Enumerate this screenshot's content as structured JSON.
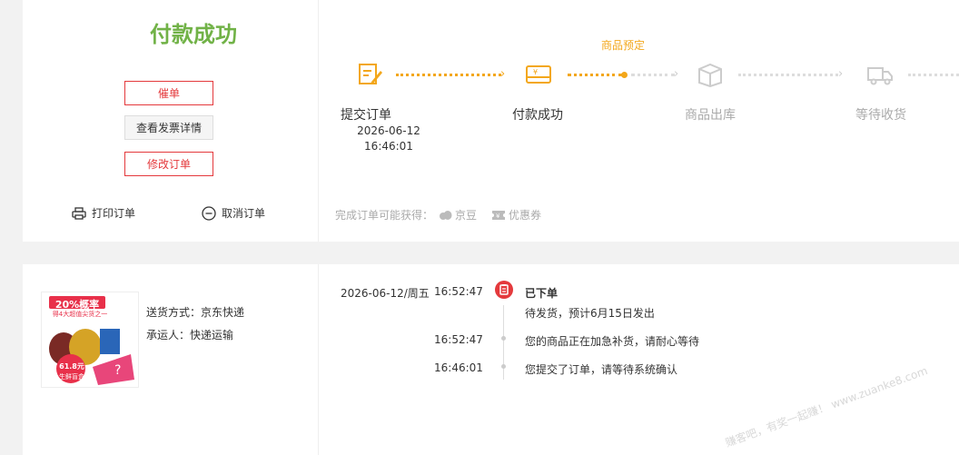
{
  "order": {
    "title": "付款成功",
    "buttons": {
      "urge": "催单",
      "invoice": "查看发票详情",
      "modify": "修改订单"
    },
    "ops": {
      "print": "打印订单",
      "cancel": "取消订单"
    }
  },
  "progress": {
    "badge": "商品预定",
    "steps": [
      {
        "label": "提交订单",
        "date": "2026-06-12",
        "time": "16:46:01",
        "state": "done"
      },
      {
        "label": "付款成功",
        "state": "done"
      },
      {
        "label": "商品出库",
        "state": "pending"
      },
      {
        "label": "等待收货",
        "state": "pending"
      }
    ],
    "reward_prefix": "完成订单可能获得：",
    "rewards": [
      "京豆",
      "优惠券"
    ]
  },
  "colors": {
    "success": "#71b247",
    "accent": "#f3a71b",
    "danger": "#e4393c",
    "muted": "#aaaaaa"
  },
  "promo": {
    "rate": "20%概率",
    "sub": "得4大超值尖货之一",
    "price": "61.8元",
    "box": "生鲜盲盒"
  },
  "shipping": {
    "method": "送货方式：京东快递",
    "carrier": "承运人：快递运输"
  },
  "tracking": {
    "date": "2026-06-12/周五",
    "events": [
      {
        "time": "16:52:47",
        "title": "已下单",
        "text": "待发货，预计6月15日发出"
      },
      {
        "time": "16:52:47",
        "text": "您的商品正在加急补货，请耐心等待"
      },
      {
        "time": "16:46:01",
        "text": "您提交了订单，请等待系统确认"
      }
    ]
  },
  "watermark": "赚客吧，有奖一起赚！ www.zuanke8.com"
}
